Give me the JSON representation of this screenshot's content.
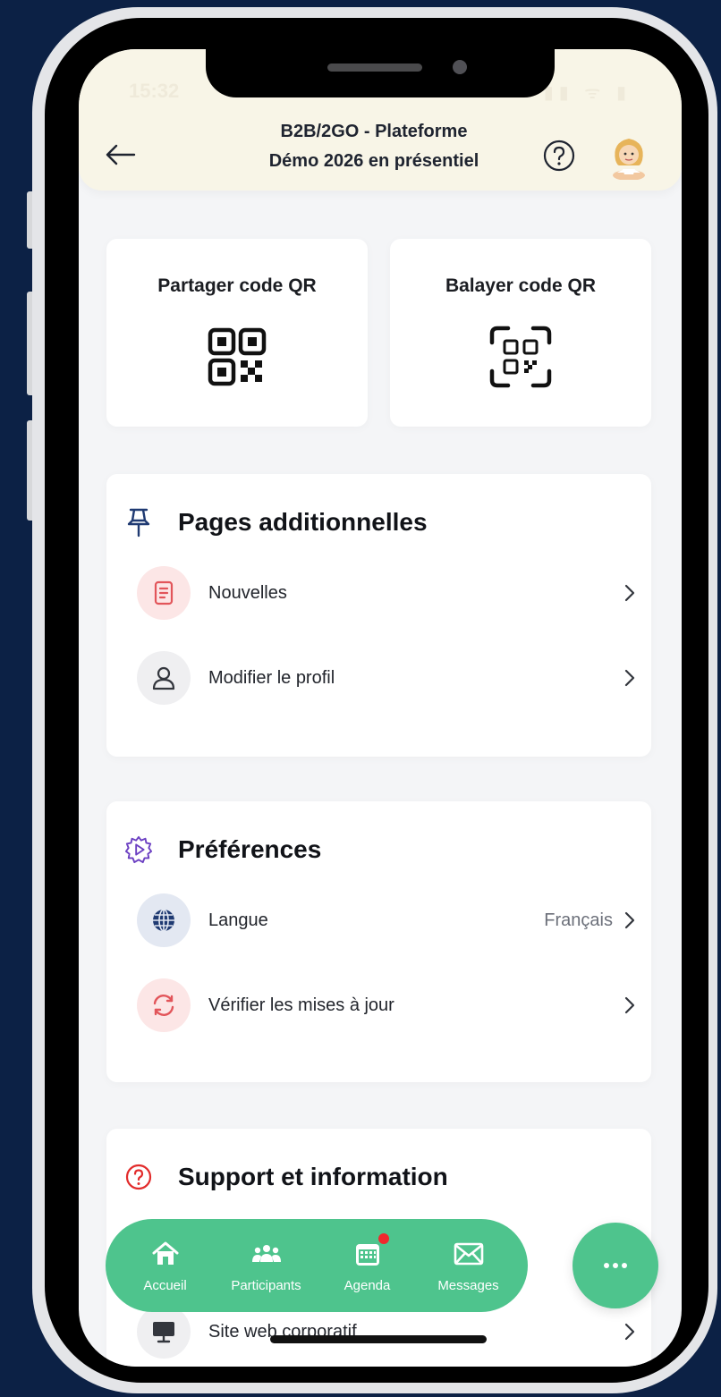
{
  "status": {
    "time": "15:32",
    "icons": "▮▮ ᯤ ▮"
  },
  "header": {
    "title_line1": "B2B/2GO - Plateforme",
    "title_line2": "Démo 2026 en présentiel",
    "back_icon": "arrow-left-icon",
    "help_icon": "help-circle-icon"
  },
  "quick_actions": {
    "share_qr_label": "Partager code QR",
    "scan_qr_label": "Balayer code QR"
  },
  "sections": {
    "pages": {
      "title": "Pages additionnelles",
      "items": [
        {
          "label": "Nouvelles",
          "icon": "news-icon"
        },
        {
          "label": "Modifier le profil",
          "icon": "user-icon"
        }
      ]
    },
    "preferences": {
      "title": "Préférences",
      "items": [
        {
          "label": "Langue",
          "value": "Français",
          "icon": "globe-icon"
        },
        {
          "label": "Vérifier les mises à jour",
          "icon": "refresh-icon"
        }
      ]
    },
    "support": {
      "title": "Support et information",
      "items": [
        {
          "label": "Site web corporatif",
          "icon": "monitor-icon"
        }
      ]
    }
  },
  "bottom_nav": {
    "items": [
      {
        "label": "Accueil",
        "icon": "home-icon"
      },
      {
        "label": "Participants",
        "icon": "people-icon"
      },
      {
        "label": "Agenda",
        "icon": "calendar-icon"
      },
      {
        "label": "Messages",
        "icon": "mail-icon"
      }
    ],
    "more_icon": "more-dots-icon"
  },
  "colors": {
    "background": "#0c2145",
    "header_bg": "#f8f5e7",
    "accent_green": "#4ec48d",
    "news_red": "#e2555a",
    "globe_blue": "#1f3a72",
    "preferences_purple": "#6b3fc2",
    "support_red": "#e22b2b",
    "badge_red": "#f0282d"
  }
}
